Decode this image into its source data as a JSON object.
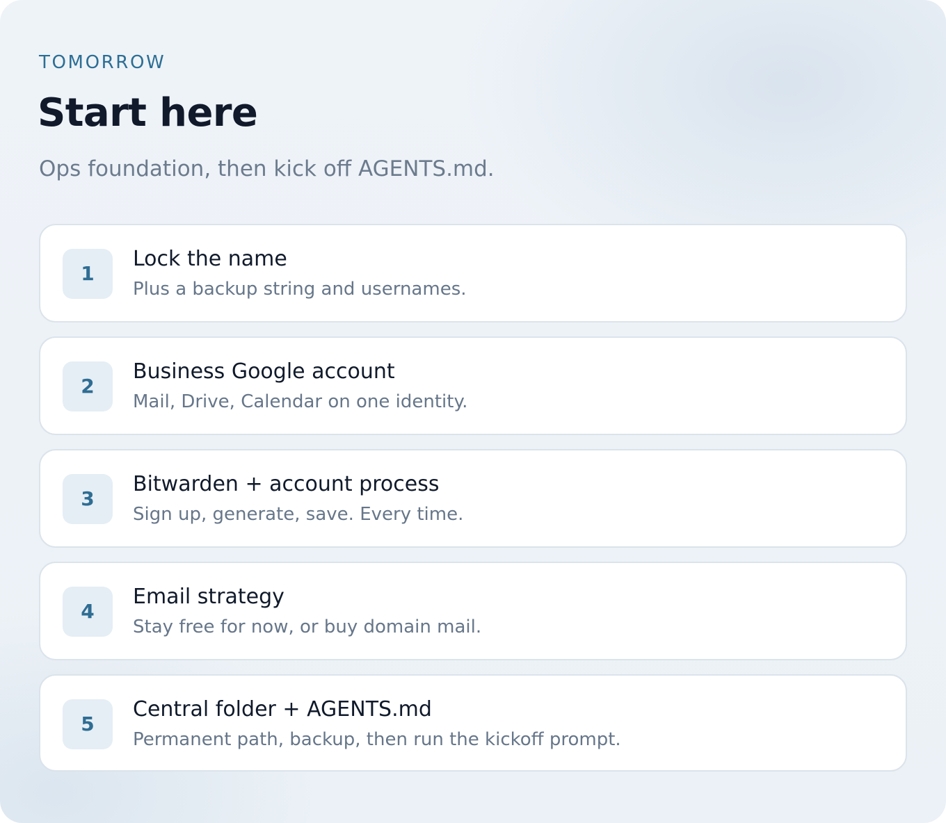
{
  "header": {
    "eyebrow": "TOMORROW",
    "title": "Start here",
    "subtitle": "Ops foundation, then kick off AGENTS.md."
  },
  "steps": [
    {
      "number": "1",
      "title": "Lock the name",
      "description": "Plus a backup string and usernames."
    },
    {
      "number": "2",
      "title": "Business Google account",
      "description": "Mail, Drive, Calendar on one identity."
    },
    {
      "number": "3",
      "title": "Bitwarden + account process",
      "description": "Sign up, generate, save. Every time."
    },
    {
      "number": "4",
      "title": "Email strategy",
      "description": "Stay free for now, or buy domain mail."
    },
    {
      "number": "5",
      "title": "Central folder + AGENTS.md",
      "description": "Permanent path, backup, then run the kickoff prompt."
    }
  ],
  "colors": {
    "accent": "#2c6e94",
    "title_text": "#111a2b",
    "muted_text": "#6c7b8d",
    "badge_background": "#e5eef5",
    "card_border": "#dbe3eb",
    "panel_background": "#edf2f7"
  }
}
